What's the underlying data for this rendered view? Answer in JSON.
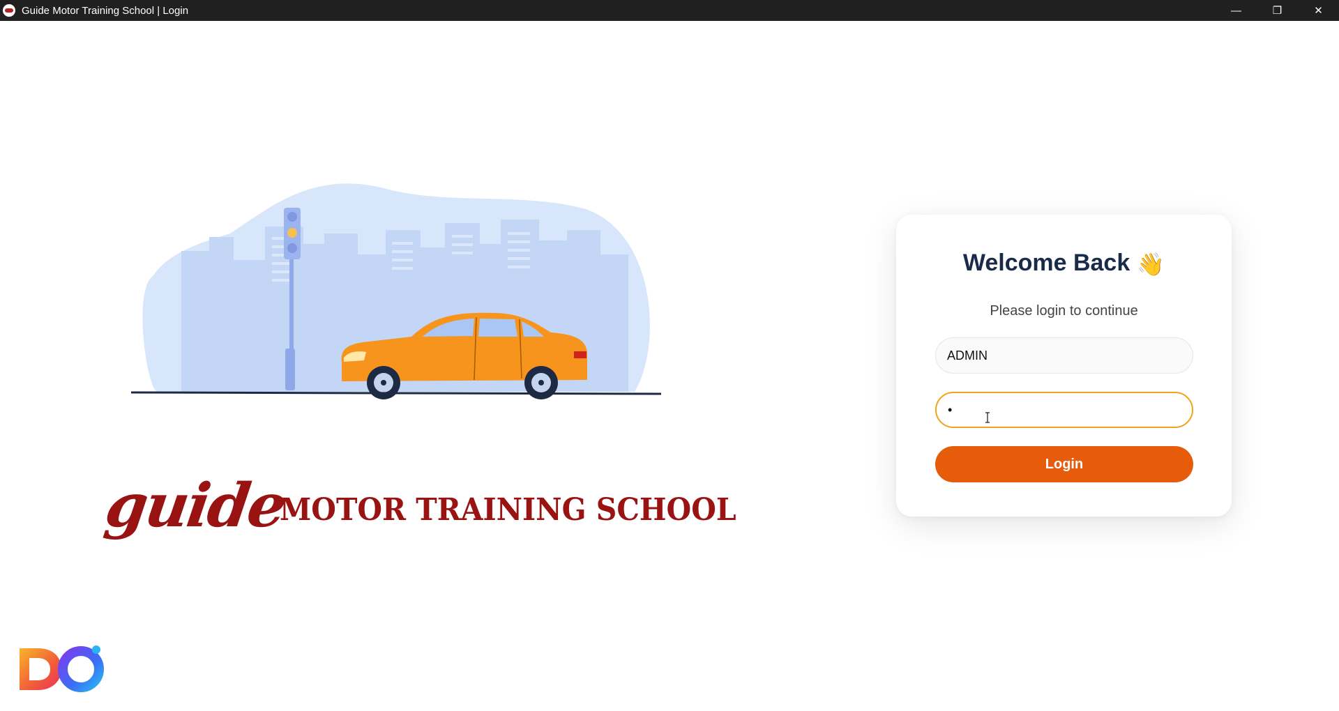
{
  "window": {
    "title": "Guide Motor Training School | Login",
    "app_icon": "app-logo-icon",
    "controls": {
      "minimize": "—",
      "restore": "❐",
      "close": "✕"
    }
  },
  "brand": {
    "logo_word": "guide",
    "logo_text": "MOTOR TRAINING SCHOOL",
    "color": "#9a1313"
  },
  "login": {
    "heading": "Welcome Back",
    "wave_icon": "👋",
    "subtitle": "Please login to continue",
    "username_value": "ADMIN",
    "password_value": "•",
    "button_label": "Login",
    "accent_color": "#e65c0a",
    "focus_color": "#f0a417"
  }
}
